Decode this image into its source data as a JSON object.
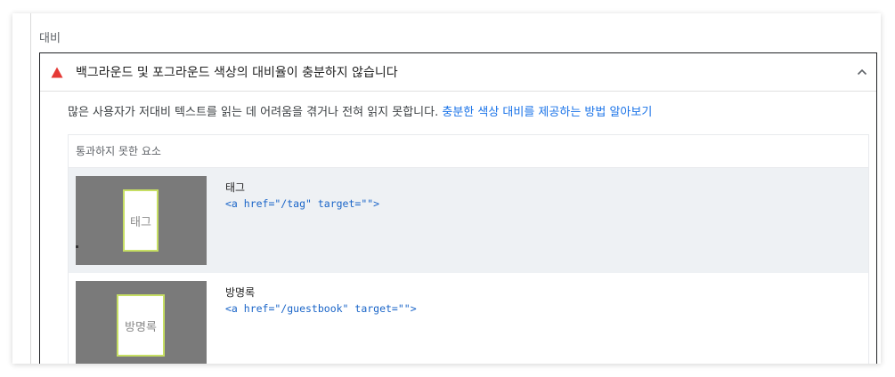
{
  "section": {
    "label": "대비"
  },
  "audit": {
    "title": "백그라운드 및 포그라운드 색상의 대비율이 충분하지 않습니다",
    "status": "fail",
    "expanded": true,
    "description": "많은 사용자가 저대비 텍스트를 읽는 데 어려움을 겪거나 전혀 읽지 못합니다.",
    "learn_more": "충분한 색상 대비를 제공하는 방법 알아보기"
  },
  "table": {
    "header": "통과하지 못한 요소",
    "rows": [
      {
        "label": "태그",
        "snippet": "<a href=\"/tag\" target=\"\">",
        "thumb_text": "태그",
        "shaded": true
      },
      {
        "label": "방명록",
        "snippet": "<a href=\"/guestbook\" target=\"\">",
        "thumb_text": "방명록",
        "shaded": false
      }
    ]
  },
  "colors": {
    "fail": "#e53935",
    "link": "#1a73e8",
    "code": "#1a65c8",
    "highlight_border": "#c6de63",
    "thumb_bg": "#7a7a7a",
    "row_shaded": "#eef1f4"
  },
  "icons": {
    "status": "warning-triangle-icon",
    "toggle": "chevron-up-icon"
  }
}
